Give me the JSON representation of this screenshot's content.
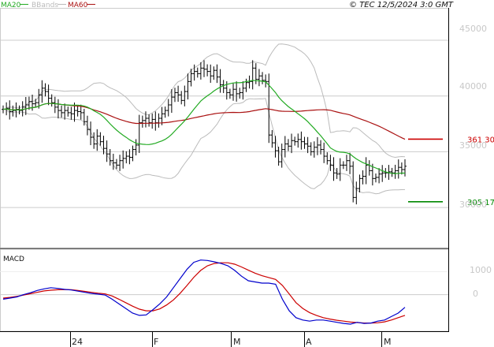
{
  "header": {
    "legend": [
      {
        "label": "MA20",
        "color": "#22aa22"
      },
      {
        "label": "BBands",
        "color": "#bbbbbb"
      },
      {
        "label": "MA60",
        "color": "#aa1111"
      }
    ],
    "source": "© TEC 12/5/2024 3:0 GMT"
  },
  "chart_data": [
    {
      "type": "ohlc",
      "title": "",
      "y_ticks": [
        "45000",
        "40000",
        "35000",
        "30000"
      ],
      "y_tick_values": [
        45000,
        40000,
        35000,
        30000
      ],
      "ylim": [
        26400,
        47900
      ],
      "x_ticks": [
        "24",
        "F",
        "M",
        "A",
        "M"
      ],
      "grid": true,
      "legend_placement": "top-left",
      "annotations": [
        {
          "text": "361 30",
          "value": 36130,
          "color": "#cc0000"
        },
        {
          "text": "305 17",
          "value": 30517,
          "color": "#008800"
        }
      ],
      "close": [
        38800,
        38900,
        38600,
        38700,
        38800,
        38700,
        39000,
        39200,
        39500,
        39300,
        39400,
        40100,
        40700,
        40400,
        39800,
        39400,
        39000,
        38700,
        38500,
        38700,
        38500,
        38400,
        38700,
        38600,
        38500,
        37700,
        37000,
        36300,
        35700,
        36400,
        35900,
        35300,
        34800,
        34200,
        34000,
        33800,
        34200,
        34400,
        34600,
        34500,
        35200,
        35600,
        37600,
        37800,
        38000,
        37600,
        37900,
        37600,
        38000,
        38400,
        38700,
        39200,
        39900,
        40300,
        40100,
        39600,
        40400,
        41300,
        42000,
        42200,
        42000,
        42500,
        42400,
        42200,
        41800,
        42300,
        41700,
        41000,
        40700,
        40300,
        40100,
        40600,
        40200,
        40300,
        40700,
        41200,
        41300,
        42500,
        41500,
        41800,
        41400,
        41300,
        36500,
        35800,
        35100,
        34100,
        35200,
        35700,
        35500,
        36000,
        35900,
        36100,
        35900,
        35700,
        35500,
        35000,
        35400,
        35600,
        35200,
        34600,
        34200,
        33800,
        33100,
        33000,
        33800,
        33800,
        34200,
        33700,
        30900,
        31700,
        32600,
        32800,
        33800,
        33300,
        32600,
        32700,
        33000,
        33100,
        33100,
        33200,
        33100,
        33300,
        33600,
        33400,
        33700
      ]
    },
    {
      "type": "line",
      "title": "MACD",
      "y_ticks": [
        "1000",
        "0"
      ],
      "y_tick_values": [
        1000,
        0
      ],
      "ylim": [
        -1450,
        1900
      ],
      "series": [
        {
          "name": "MACD",
          "color": "#0000cc",
          "values": [
            -200,
            -150,
            -100,
            0,
            80,
            180,
            250,
            300,
            270,
            230,
            200,
            150,
            100,
            50,
            20,
            -20,
            -200,
            -400,
            -600,
            -800,
            -900,
            -880,
            -650,
            -400,
            -100,
            300,
            700,
            1100,
            1400,
            1500,
            1480,
            1420,
            1350,
            1250,
            1050,
            800,
            600,
            550,
            500,
            500,
            450,
            -200,
            -700,
            -1000,
            -1100,
            -1150,
            -1100,
            -1100,
            -1150,
            -1200,
            -1250,
            -1280,
            -1200,
            -1250,
            -1230,
            -1150,
            -1100,
            -950,
            -800,
            -550
          ]
        },
        {
          "name": "Signal",
          "color": "#cc0000",
          "values": [
            -150,
            -120,
            -80,
            -20,
            40,
            100,
            160,
            190,
            210,
            220,
            210,
            180,
            140,
            100,
            60,
            30,
            -60,
            -200,
            -350,
            -500,
            -630,
            -700,
            -700,
            -620,
            -450,
            -230,
            60,
            400,
            750,
            1050,
            1250,
            1350,
            1380,
            1380,
            1320,
            1200,
            1060,
            930,
            820,
            740,
            660,
            400,
            30,
            -350,
            -600,
            -780,
            -900,
            -1000,
            -1060,
            -1110,
            -1150,
            -1190,
            -1210,
            -1230,
            -1230,
            -1220,
            -1180,
            -1100,
            -1000,
            -900
          ]
        }
      ]
    }
  ]
}
